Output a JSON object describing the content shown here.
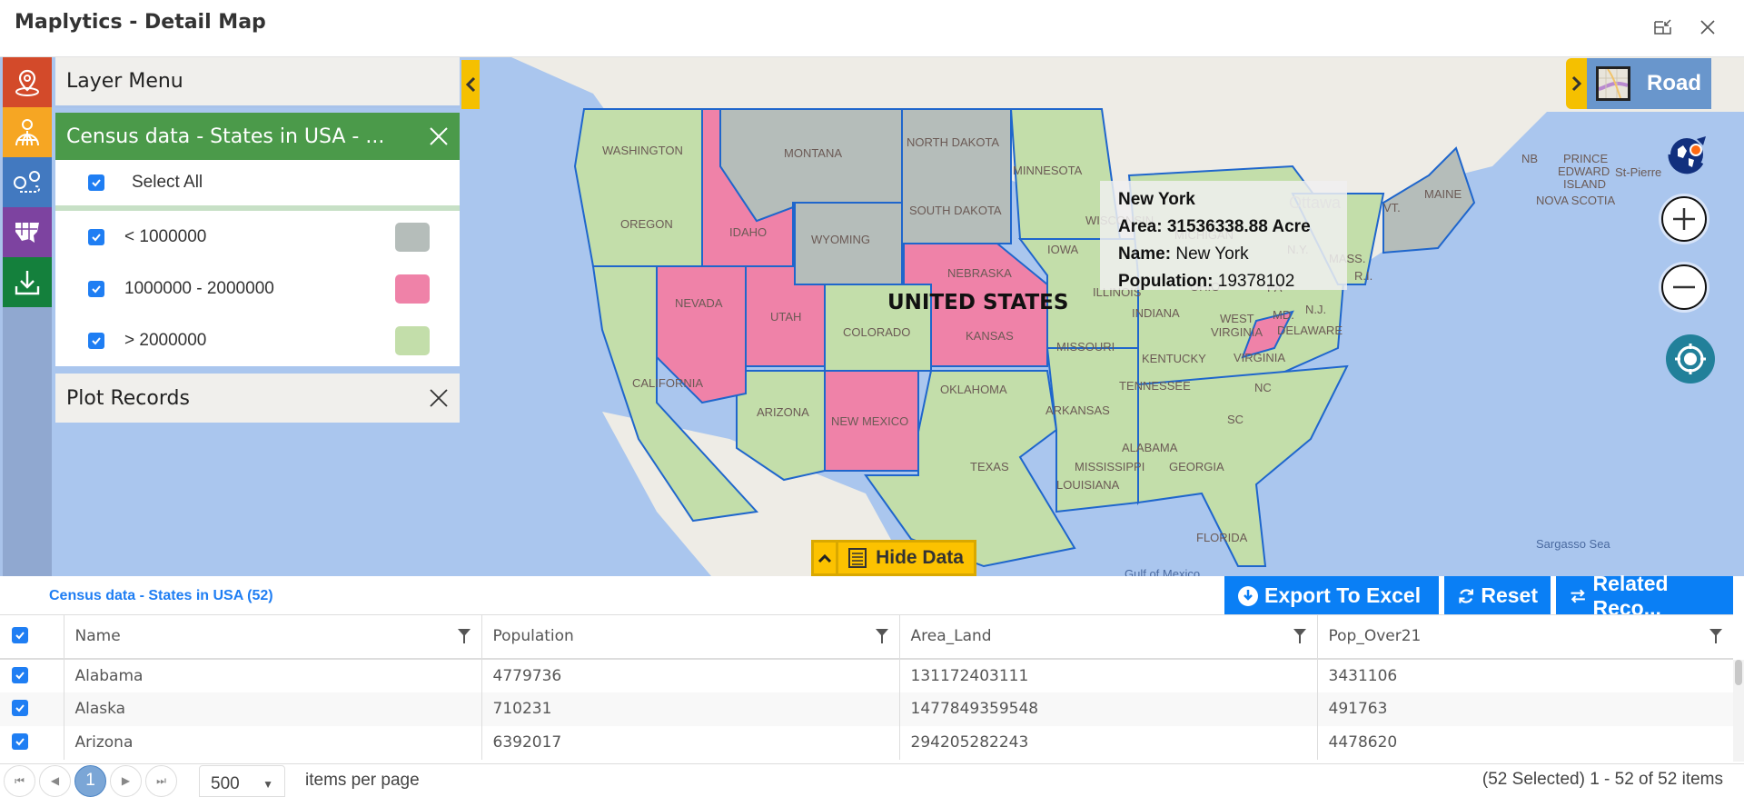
{
  "window": {
    "title": "Maplytics - Detail Map"
  },
  "layer_menu": {
    "title": "Layer Menu",
    "layer": {
      "title": "Census data - States in USA - ...",
      "select_all": "Select All",
      "legend": [
        {
          "label": "< 1000000",
          "color": "#b5bdba",
          "checked": true
        },
        {
          "label": "1000000 - 2000000",
          "color": "#ef82a8",
          "checked": true
        },
        {
          "label": "> 2000000",
          "color": "#c3deaa",
          "checked": true
        }
      ]
    },
    "plot_records": "Plot Records"
  },
  "sidebar": {
    "items": [
      {
        "icon": "location-pin-icon",
        "color": "#d34a2a"
      },
      {
        "icon": "territory-globe-icon",
        "color": "#f6a623"
      },
      {
        "icon": "route-icon",
        "color": "#4279c0"
      },
      {
        "icon": "us-map-icon",
        "color": "#7d43a0"
      },
      {
        "icon": "download-icon",
        "color": "#14803c"
      }
    ]
  },
  "map": {
    "style_label": "Road",
    "country_label": "UNITED STATES",
    "tooltip": {
      "name": "New York",
      "area_label": "Area:",
      "area_value": "31536338.88 Acre",
      "name_label": "Name:",
      "name_value": "New York",
      "population_label": "Population:",
      "population_value": "19378102"
    },
    "state_labels": [
      "WASHINGTON",
      "OREGON",
      "CALIFORNIA",
      "IDAHO",
      "NEVADA",
      "UTAH",
      "ARIZONA",
      "MONTANA",
      "WYOMING",
      "COLORADO",
      "NEW MEXICO",
      "NORTH DAKOTA",
      "SOUTH DAKOTA",
      "NEBRASKA",
      "KANSAS",
      "OKLAHOMA",
      "TEXAS",
      "MINNESOTA",
      "IOWA",
      "MISSOURI",
      "ARKANSAS",
      "LOUISIANA",
      "ILLINOIS",
      "INDIANA",
      "OHIO",
      "KENTUCKY",
      "TENNESSEE",
      "MISSISSIPPI",
      "ALABAMA",
      "GEORGIA",
      "FLORIDA",
      "SC",
      "NC",
      "VIRGINIA",
      "WEST VIRGINIA",
      "PA",
      "N.Y.",
      "MD.",
      "N.J.",
      "DELAWARE",
      "MASS.",
      "R.I.",
      "VT.",
      "MAINE",
      "MICHIGAN",
      "WISCONSIN"
    ],
    "other_labels": [
      "Ottawa",
      "NB",
      "PRINCE EDWARD ISLAND",
      "NOVA SCOTIA",
      "St-Pierre",
      "Sargasso Sea",
      "Gulf of Mexico"
    ],
    "hide_data": "Hide Data"
  },
  "grid": {
    "title": "Census data - States in USA (52)",
    "actions": {
      "export": "Export To Excel",
      "reset": "Reset",
      "related": "Related Reco..."
    },
    "columns": [
      "Name",
      "Population",
      "Area_Land",
      "Pop_Over21"
    ],
    "rows": [
      [
        "Alabama",
        "4779736",
        "131172403111",
        "3431106"
      ],
      [
        "Alaska",
        "710231",
        "1477849359548",
        "491763"
      ],
      [
        "Arizona",
        "6392017",
        "294205282243",
        "4478620"
      ]
    ],
    "pager": {
      "current_page": "1",
      "page_size": "500",
      "per_page_label": "items per page",
      "info": "(52 Selected) 1 - 52 of 52 items"
    }
  }
}
